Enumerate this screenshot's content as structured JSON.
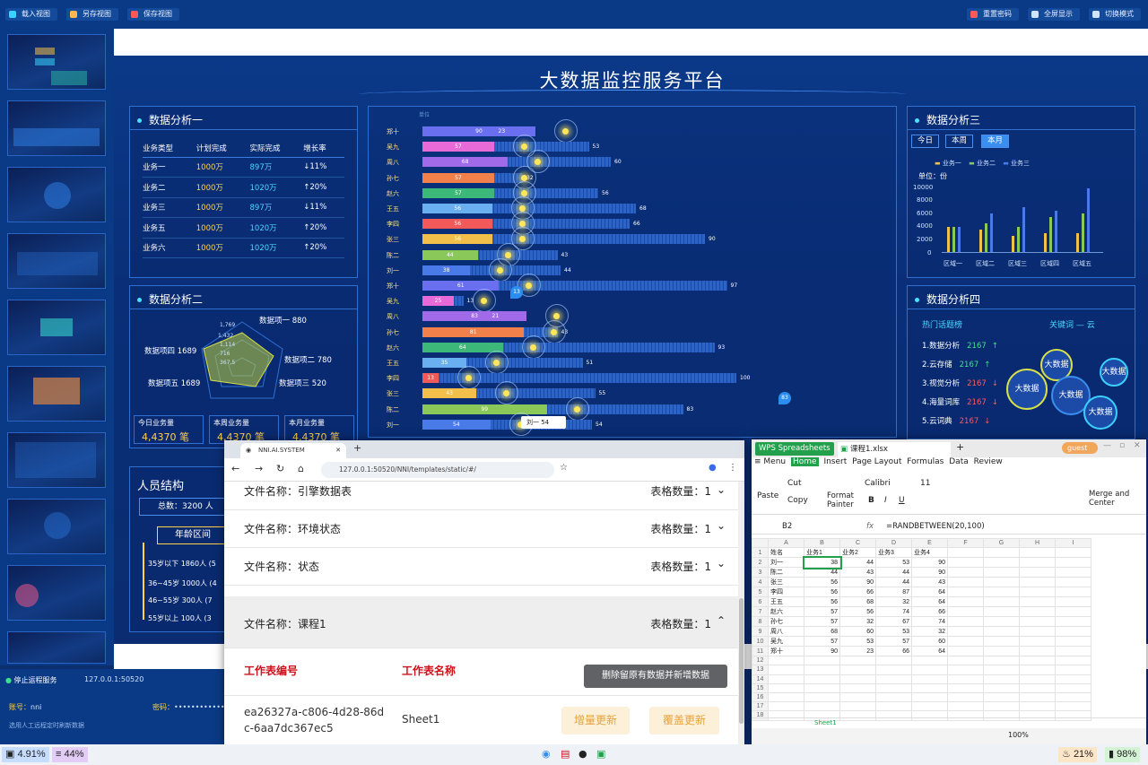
{
  "toolbar": {
    "left": [
      "载入视图",
      "另存视图",
      "保存视图"
    ],
    "right": [
      "重置密码",
      "全屏显示",
      "切换模式"
    ]
  },
  "dashboard": {
    "title": "大数据监控服务平台",
    "p1": {
      "title": "数据分析一",
      "headers": [
        "业务类型",
        "计划完成",
        "实际完成",
        "增长率"
      ],
      "rows": [
        [
          "业务一",
          "1000万",
          "897万",
          "↓11%"
        ],
        [
          "业务二",
          "1000万",
          "1020万",
          "↑20%"
        ],
        [
          "业务三",
          "1000万",
          "897万",
          "↓11%"
        ],
        [
          "业务五",
          "1000万",
          "1020万",
          "↑20%"
        ],
        [
          "业务六",
          "1000万",
          "1020万",
          "↑20%"
        ]
      ]
    },
    "p2": {
      "title": "数据分析二",
      "radar_labels": [
        "数据项一 880",
        "数据项二 780",
        "数据项三 520",
        "数据项五 1689",
        "数据项四 1689"
      ],
      "radar_ticks": [
        "1,769",
        "1,432",
        "1,114",
        "716",
        "367.5"
      ],
      "stats": [
        {
          "label": "今日业务量",
          "value": "4,4370 笔"
        },
        {
          "label": "本周业务量",
          "value": "4,4370 笔"
        },
        {
          "label": "本月业务量",
          "value": "4,4370 笔"
        }
      ]
    },
    "people": {
      "title": "人员结构",
      "total": "总数：3200 人",
      "age_title": "年龄区间",
      "ages": [
        "35岁以下 1860人 (5",
        "36~45岁 1000人 (4",
        "46~55岁 300人 (7",
        "55岁以上 100人 (3"
      ]
    },
    "bars": {
      "corner": "单位",
      "items": [
        {
          "name": "郑十",
          "v": 90,
          "end": 23,
          "color": "#6a6ff0"
        },
        {
          "name": "吴九",
          "v": 57,
          "end": 53,
          "color": "#e86ad8"
        },
        {
          "name": "周八",
          "v": 68,
          "end": 60,
          "color": "#a06ae8"
        },
        {
          "name": "孙七",
          "v": 57,
          "end": 32,
          "color": "#f2804a"
        },
        {
          "name": "赵六",
          "v": 57,
          "end": 56,
          "color": "#3cb878"
        },
        {
          "name": "王五",
          "v": 56,
          "end": 68,
          "color": "#6ab0f0"
        },
        {
          "name": "李四",
          "v": 56,
          "end": 66,
          "color": "#f25a5a"
        },
        {
          "name": "张三",
          "v": 56,
          "end": 90,
          "color": "#f2c04a"
        },
        {
          "name": "陈二",
          "v": 44,
          "end": 43,
          "color": "#8ac85a"
        },
        {
          "name": "刘一",
          "v": 38,
          "end": 44,
          "color": "#4a7ae8"
        },
        {
          "name": "郑十",
          "v": 61,
          "end": 97,
          "color": "#6a6ff0"
        },
        {
          "name": "吴九",
          "v": 25,
          "end": 13,
          "color": "#e86ad8"
        },
        {
          "name": "周八",
          "v": 83,
          "end": 21,
          "color": "#a06ae8"
        },
        {
          "name": "孙七",
          "v": 81,
          "end": 43,
          "color": "#f2804a"
        },
        {
          "name": "赵六",
          "v": 64,
          "end": 93,
          "color": "#3cb878"
        },
        {
          "name": "王五",
          "v": 35,
          "end": 51,
          "color": "#6ab0f0"
        },
        {
          "name": "李四",
          "v": 13,
          "end": 100,
          "color": "#f25a5a"
        },
        {
          "name": "张三",
          "v": 43,
          "end": 55,
          "color": "#f2c04a"
        },
        {
          "name": "陈二",
          "v": 99,
          "end": 83,
          "color": "#8ac85a"
        },
        {
          "name": "刘一",
          "v": 54,
          "end": 54,
          "color": "#4a7ae8"
        }
      ],
      "tooltip": "刘一  54",
      "pin1": "13",
      "pin2": "83"
    },
    "p3": {
      "title": "数据分析三",
      "tabs": [
        "今日",
        "本周",
        "本月"
      ],
      "legend": [
        "业务一",
        "业务二",
        "业务三"
      ],
      "unit": "单位：份",
      "yticks": [
        "10000",
        "8000",
        "6000",
        "4000",
        "2000",
        "0"
      ],
      "categories": [
        "区域一",
        "区域二",
        "区域三",
        "区域四",
        "区域五"
      ]
    },
    "p4": {
      "title": "数据分析四",
      "left_head": "热门话题榜",
      "right_head": "关键词 — 云",
      "topics": [
        {
          "t": "1.数据分析",
          "n": "2167",
          "a": "↑",
          "c": "#3ee08a"
        },
        {
          "t": "2.云存储",
          "n": "2167",
          "a": "↑",
          "c": "#3ee08a"
        },
        {
          "t": "3.视觉分析",
          "n": "2167",
          "a": "↓",
          "c": "#ff5a5a"
        },
        {
          "t": "4.海量词库",
          "n": "2167",
          "a": "↓",
          "c": "#ff5a5a"
        },
        {
          "t": "5.云词典",
          "n": "2167",
          "a": "↓",
          "c": "#ff5a5a"
        }
      ],
      "bubble": "大数据"
    }
  },
  "chart_data": {
    "type": "bar",
    "title": "",
    "categories": [
      "区域一",
      "区域二",
      "区域三",
      "区域四",
      "区域五"
    ],
    "series": [
      {
        "name": "业务一",
        "values": [
          4000,
          3500,
          2500,
          3000,
          3000
        ]
      },
      {
        "name": "业务二",
        "values": [
          4000,
          4500,
          4000,
          5500,
          6000
        ]
      },
      {
        "name": "业务三",
        "values": [
          4000,
          6000,
          7000,
          6500,
          10000
        ]
      }
    ],
    "ylabel": "单位：份",
    "ylim": [
      0,
      10000
    ]
  },
  "bottom": {
    "stop": "停止运程服务",
    "address": "127.0.0.1:50520",
    "account_label": "账号：",
    "account": "nni",
    "pwd_label": "密码：",
    "pwd": "••••••••••••",
    "hint": "选用人工远程定时刷新数据"
  },
  "browser": {
    "tab": "NNI.AI.SYSTEM",
    "url": "127.0.0.1:50520/NNI/templates/static/#/",
    "files": [
      {
        "name": "文件名称：引擎数据表",
        "count": "表格数量：1"
      },
      {
        "name": "文件名称：环境状态",
        "count": "表格数量：1"
      },
      {
        "name": "文件名称：状态",
        "count": "表格数量：1"
      },
      {
        "name": "文件名称：课程1",
        "count": "表格数量：1"
      }
    ],
    "col_id": "工作表编号",
    "col_name": "工作表名称",
    "tooltip": "删除留原有数据并新增数据",
    "sheet_id": "ea26327a-c806-4d28-86dc-6aa7dc367ec5",
    "sheet_name": "Sheet1",
    "btn1": "增量更新",
    "btn2": "覆盖更新"
  },
  "wps": {
    "app": "WPS Spreadsheets",
    "file": "课程1.xlsx",
    "user": "guest",
    "menu": [
      "≡ Menu",
      "Home",
      "Insert",
      "Page Layout",
      "Formulas",
      "Data",
      "Review"
    ],
    "ribbon": [
      "Paste",
      "Cut",
      "Copy",
      "Format Painter",
      "Calibri",
      "11",
      "Merge and Center"
    ],
    "cell": "B2",
    "fx": "fx",
    "formula": "=RANDBETWEEN(20,100)",
    "cols": [
      "",
      "A",
      "B",
      "C",
      "D",
      "E",
      "F",
      "G",
      "H",
      "I"
    ],
    "rows": [
      [
        "姓名",
        "业务1",
        "业务2",
        "业务3",
        "业务4"
      ],
      [
        "刘一",
        "38",
        "44",
        "53",
        "90"
      ],
      [
        "陈二",
        "44",
        "43",
        "44",
        "90"
      ],
      [
        "张三",
        "56",
        "90",
        "44",
        "43"
      ],
      [
        "李四",
        "56",
        "66",
        "87",
        "64"
      ],
      [
        "王五",
        "56",
        "68",
        "32",
        "64"
      ],
      [
        "赵六",
        "57",
        "56",
        "74",
        "66"
      ],
      [
        "孙七",
        "57",
        "32",
        "67",
        "74"
      ],
      [
        "周八",
        "68",
        "60",
        "53",
        "32"
      ],
      [
        "吴九",
        "57",
        "53",
        "57",
        "60"
      ],
      [
        "郑十",
        "90",
        "23",
        "66",
        "64"
      ]
    ],
    "sheet_tab": "Sheet1",
    "zoom": "100%"
  },
  "taskbar": {
    "cpu": "4.91%",
    "mem": "44%",
    "light": "21%",
    "battery": "98%"
  }
}
